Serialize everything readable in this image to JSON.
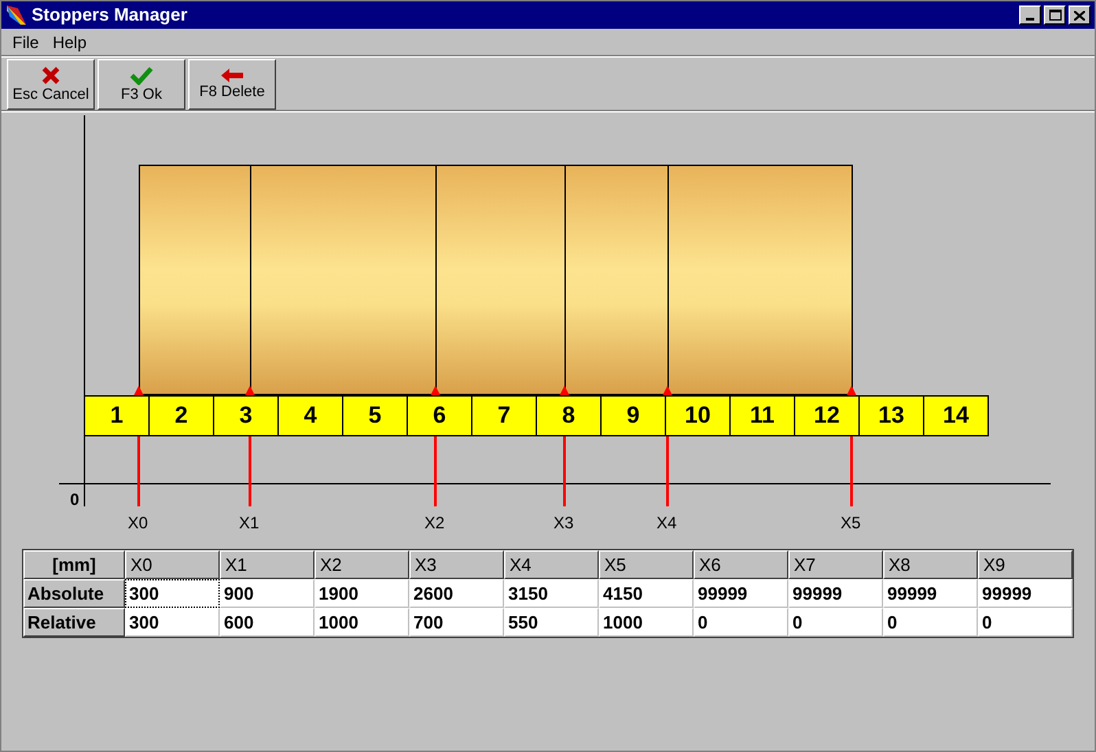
{
  "window": {
    "title": "Stoppers Manager"
  },
  "menu": [
    "File",
    "Help"
  ],
  "toolbar": [
    {
      "kind": "cancel",
      "label": "Esc Cancel"
    },
    {
      "kind": "ok",
      "label": "F3 Ok"
    },
    {
      "kind": "delete",
      "label": "F8 Delete"
    }
  ],
  "diagram": {
    "origin_label": "0",
    "cells": [
      "1",
      "2",
      "3",
      "4",
      "5",
      "6",
      "7",
      "8",
      "9",
      "10",
      "11",
      "12",
      "13",
      "14"
    ],
    "stoppers": [
      "X0",
      "X1",
      "X2",
      "X3",
      "X4",
      "X5"
    ]
  },
  "table": {
    "columns": [
      "[mm]",
      "X0",
      "X1",
      "X2",
      "X3",
      "X4",
      "X5",
      "X6",
      "X7",
      "X8",
      "X9"
    ],
    "rows": [
      {
        "cells": [
          {
            "value": "Absolute"
          },
          {
            "value": "300",
            "focused": true
          },
          {
            "value": "900",
            "focused": false
          },
          {
            "value": "1900",
            "focused": false
          },
          {
            "value": "2600",
            "focused": false
          },
          {
            "value": "3150",
            "focused": false
          },
          {
            "value": "4150",
            "focused": false
          },
          {
            "value": "99999",
            "focused": false
          },
          {
            "value": "99999",
            "focused": false
          },
          {
            "value": "99999",
            "focused": false
          },
          {
            "value": "99999",
            "focused": false
          }
        ]
      },
      {
        "cells": [
          {
            "value": "Relative"
          },
          {
            "value": "300",
            "focused": false
          },
          {
            "value": "600",
            "focused": false
          },
          {
            "value": "1000",
            "focused": false
          },
          {
            "value": "700",
            "focused": false
          },
          {
            "value": "550",
            "focused": false
          },
          {
            "value": "1000",
            "focused": false
          },
          {
            "value": "0",
            "focused": false
          },
          {
            "value": "0",
            "focused": false
          },
          {
            "value": "0",
            "focused": false
          },
          {
            "value": "0",
            "focused": false
          }
        ]
      }
    ]
  }
}
